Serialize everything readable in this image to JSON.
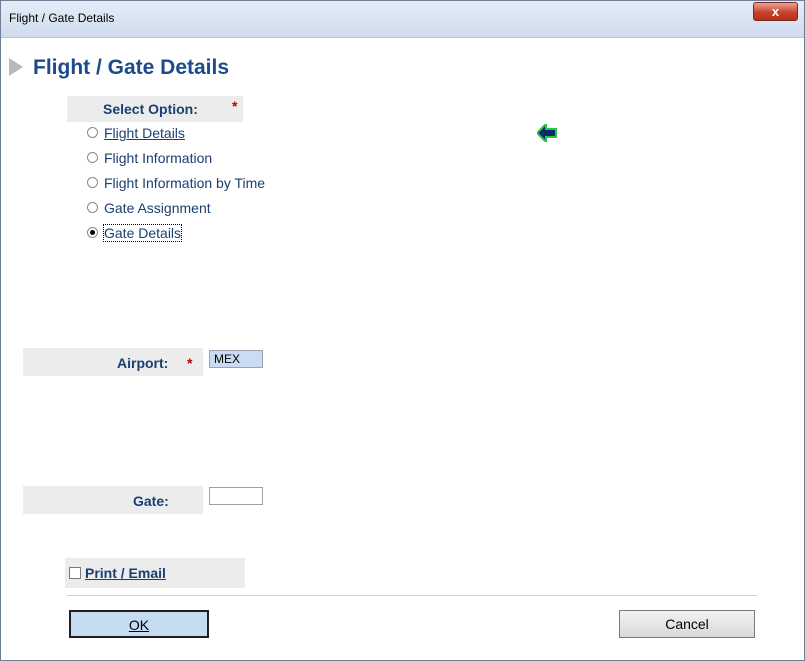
{
  "window": {
    "title": "Flight / Gate Details",
    "close_label": "x"
  },
  "page": {
    "heading": "Flight / Gate Details"
  },
  "select_option": {
    "label": "Select Option:",
    "required": "*",
    "options": [
      {
        "label": "Flight Details",
        "selected": false
      },
      {
        "label": "Flight Information",
        "selected": false
      },
      {
        "label": "Flight Information by Time",
        "selected": false
      },
      {
        "label": "Gate Assignment",
        "selected": false
      },
      {
        "label": "Gate Details",
        "selected": true
      }
    ]
  },
  "airport": {
    "label": "Airport:",
    "required": "*",
    "value": "MEX"
  },
  "gate": {
    "label": "Gate:",
    "value": ""
  },
  "print_email": {
    "label": "Print / Email",
    "checked": false
  },
  "buttons": {
    "ok": "OK",
    "cancel": "Cancel"
  },
  "icons": {
    "back": "back-arrow-icon"
  },
  "colors": {
    "heading": "#1d4a8a",
    "label": "#1b3f73",
    "required": "#c00000",
    "airport_input_bg": "#c9dcf4"
  }
}
